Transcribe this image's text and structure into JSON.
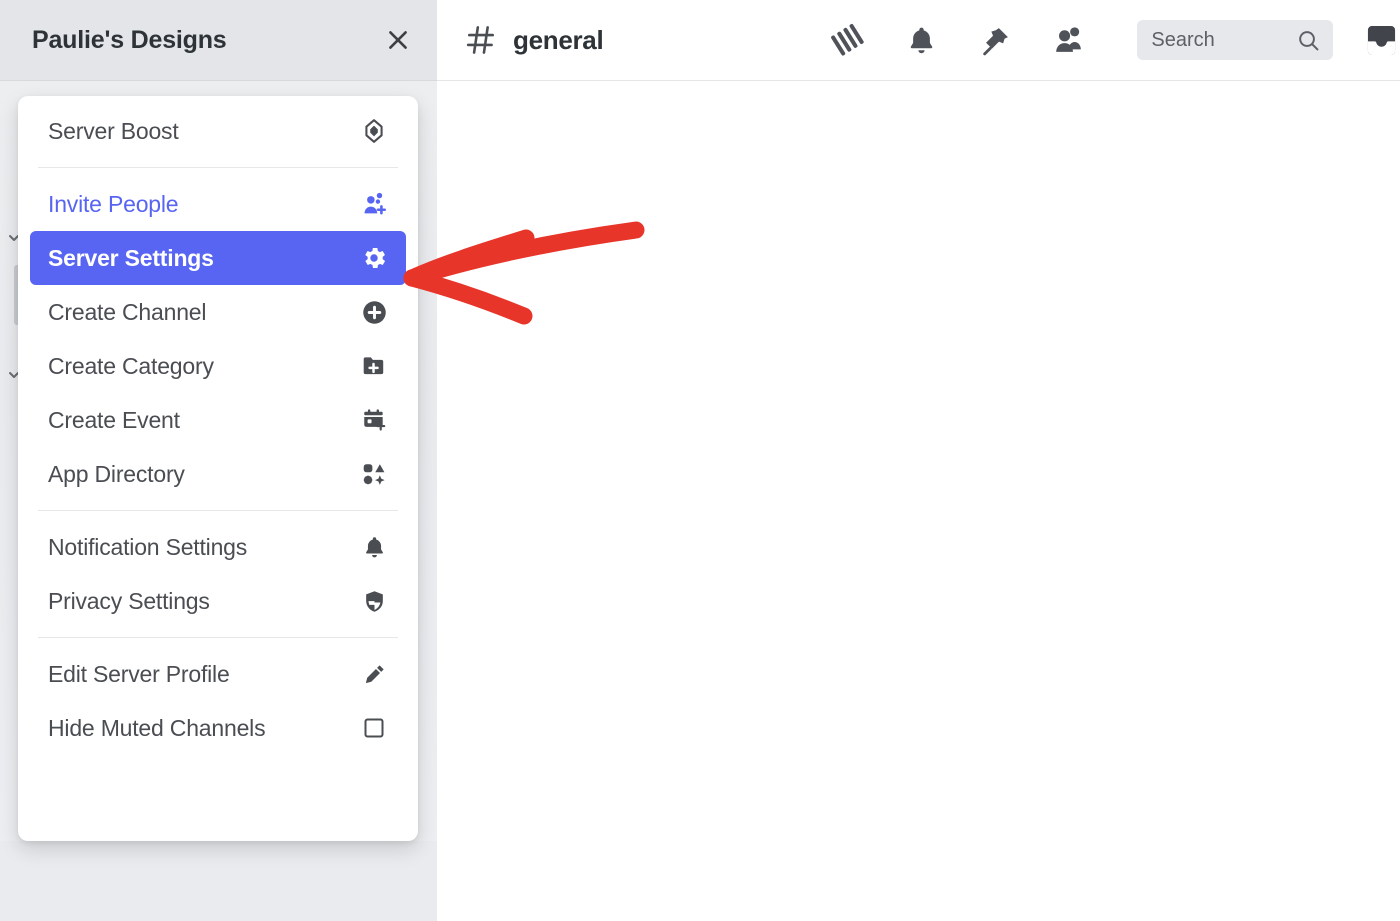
{
  "sidebar": {
    "server_name": "Paulie's Designs",
    "close_icon": "close-icon"
  },
  "menu": {
    "groups": [
      {
        "items": [
          {
            "label": "Server Boost",
            "icon": "server-boost-icon",
            "state": "normal"
          }
        ]
      },
      {
        "items": [
          {
            "label": "Invite People",
            "icon": "invite-people-icon",
            "state": "accent"
          },
          {
            "label": "Server Settings",
            "icon": "gear-icon",
            "state": "selected"
          },
          {
            "label": "Create Channel",
            "icon": "plus-circle-icon",
            "state": "normal"
          },
          {
            "label": "Create Category",
            "icon": "folder-plus-icon",
            "state": "normal"
          },
          {
            "label": "Create Event",
            "icon": "calendar-plus-icon",
            "state": "normal"
          },
          {
            "label": "App Directory",
            "icon": "app-directory-icon",
            "state": "normal"
          }
        ]
      },
      {
        "items": [
          {
            "label": "Notification Settings",
            "icon": "bell-icon",
            "state": "normal"
          },
          {
            "label": "Privacy Settings",
            "icon": "shield-icon",
            "state": "normal"
          }
        ]
      },
      {
        "items": [
          {
            "label": "Edit Server Profile",
            "icon": "pencil-icon",
            "state": "normal"
          },
          {
            "label": "Hide Muted Channels",
            "icon": "checkbox-unchecked-icon",
            "state": "normal"
          }
        ]
      }
    ]
  },
  "topbar": {
    "channel_name": "general",
    "channel_prefix_icon": "hash-icon",
    "icons": [
      {
        "name": "threads-icon"
      },
      {
        "name": "bell-icon"
      },
      {
        "name": "pin-icon"
      },
      {
        "name": "members-icon"
      }
    ],
    "search": {
      "placeholder": "Search",
      "value": "",
      "icon": "search-icon"
    },
    "inbox_icon": "inbox-icon"
  },
  "annotation": {
    "type": "arrow",
    "color": "#e8352a",
    "points_at": "Server Settings"
  },
  "colors": {
    "accent": "#5865f2",
    "selected_bg": "#5865f2",
    "sidebar_bg": "#e9ebee",
    "menu_bg": "#ffffff",
    "text": "#4a4d52",
    "annotation_red": "#e8352a"
  }
}
